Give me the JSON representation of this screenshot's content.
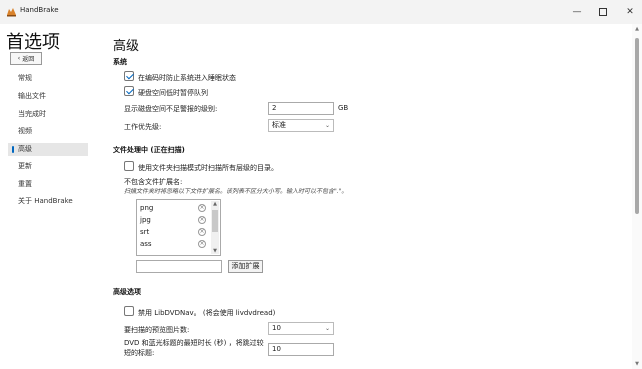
{
  "window": {
    "title": "HandBrake",
    "minimize": "—",
    "close": "✕"
  },
  "sidebar": {
    "title": "首选项",
    "back_label": "返回",
    "items": [
      {
        "label": "常规"
      },
      {
        "label": "输出文件"
      },
      {
        "label": "当完成时"
      },
      {
        "label": "视频"
      },
      {
        "label": "高级",
        "selected": true
      },
      {
        "label": "更新"
      },
      {
        "label": "重置"
      },
      {
        "label": "关于 HandBrake"
      }
    ]
  },
  "main": {
    "heading": "高级",
    "system": {
      "title": "系统",
      "prevent_sleep": {
        "label": "在编码时防止系统进入睡眠状态",
        "checked": true
      },
      "pause_queue": {
        "label": "硬盘空间低时暂停队列",
        "checked": true
      },
      "disk_space": {
        "label": "显示磁盘空间不足警报的级别:",
        "value": "2",
        "unit": "GB"
      },
      "priority": {
        "label": "工作优先级:",
        "value": "标准"
      }
    },
    "file_processing": {
      "title": "文件处理中 (正在扫描)",
      "recursive": {
        "label": "使用文件夹扫描模式时扫描所有层级的目录。",
        "checked": false
      },
      "exclude_label": "不包含文件扩展名:",
      "exclude_note": "扫描文件夹时将忽略以下文件扩展名。该列表不区分大小写。输入时可以不包含\".\"。",
      "extensions": [
        "png",
        "jpg",
        "srt",
        "ass"
      ],
      "new_extension_value": "",
      "add_button": "添加扩展"
    },
    "advanced": {
      "title": "高级选项",
      "disable_libdvdnav": {
        "label": "禁用 LibDVDNav。 (将会使用 livdvdread)",
        "checked": false
      },
      "preview_count": {
        "label": "要扫描的预览图片数:",
        "value": "10"
      },
      "min_title_duration": {
        "label_line1": "DVD 和蓝光标题的最短时长 (秒) ，将跳过较",
        "label_line2": "短的标题:",
        "value": "10"
      }
    }
  }
}
